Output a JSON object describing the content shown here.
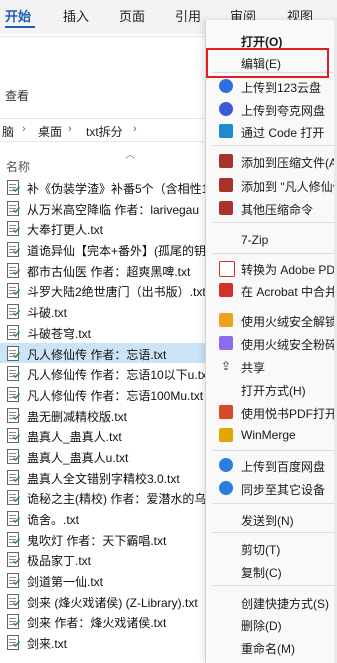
{
  "ribbon": {
    "tabs": [
      {
        "label": "开始",
        "active": true
      },
      {
        "label": "插入"
      },
      {
        "label": "页面"
      },
      {
        "label": "引用"
      },
      {
        "label": "审阅"
      },
      {
        "label": "视图"
      }
    ]
  },
  "toolbar": {
    "view_label": "查看"
  },
  "breadcrumb": [
    "脑",
    "桌面",
    "txt拆分"
  ],
  "columns": {
    "name": "名称"
  },
  "files": [
    {
      "name": "补《伪装学渣》补番5个（含相性1"
    },
    {
      "name": "从万米高空降临 作者：larivegau"
    },
    {
      "name": "大奉打更人.txt"
    },
    {
      "name": "道诡异仙【完本+番外】(孤尾的钥"
    },
    {
      "name": "都市古仙医 作者：超爽黑啤.txt"
    },
    {
      "name": "斗罗大陆2绝世唐门（出书版）.txt"
    },
    {
      "name": "斗破.txt"
    },
    {
      "name": "斗破苍穹.txt"
    },
    {
      "name": "凡人修仙传 作者：忘语.txt",
      "selected": true
    },
    {
      "name": "凡人修仙传 作者：忘语10以下u.tx"
    },
    {
      "name": "凡人修仙传 作者：忘语100Mu.txt"
    },
    {
      "name": "蛊无删减精校版.txt"
    },
    {
      "name": "蛊真人_蛊真人.txt"
    },
    {
      "name": "蛊真人_蛊真人u.txt"
    },
    {
      "name": "蛊真人全文错别字精校3.0.txt"
    },
    {
      "name": "诡秘之主(精校) 作者：爱潜水的乌"
    },
    {
      "name": "诡舍。.txt"
    },
    {
      "name": "鬼吹灯 作者：天下霸唱.txt"
    },
    {
      "name": "极品家丁.txt"
    },
    {
      "name": "剑道第一仙.txt"
    },
    {
      "name": "剑来 (烽火戏诸侯) (Z-Library).txt"
    },
    {
      "name": "剑来 作者：烽火戏诸侯.txt"
    },
    {
      "name": "剑来.txt"
    }
  ],
  "context_menu": {
    "items": [
      {
        "label": "打开(O)",
        "bold": true,
        "icon": "none"
      },
      {
        "label": "编辑(E)",
        "icon": "none",
        "highlighted": true
      },
      {
        "label": "上传到123云盘",
        "icon": "cloud-123-icon",
        "color": "#2f6fe0"
      },
      {
        "label": "上传到夸克网盘",
        "icon": "quark-icon",
        "color": "#3b5bdb"
      },
      {
        "label": "通过 Code 打开",
        "icon": "vscode-icon",
        "color": "#1f8ad2"
      },
      {
        "label": "添加到压缩文件(A)",
        "icon": "archive-icon",
        "color": "#a8332a"
      },
      {
        "label": "添加到 \"凡人修仙传",
        "icon": "archive-icon",
        "color": "#a8332a"
      },
      {
        "label": "其他压缩命令",
        "icon": "archive-icon",
        "color": "#a8332a"
      },
      {
        "label": "7-Zip",
        "icon": "none"
      },
      {
        "label": "转换为 Adobe PD",
        "icon": "pdf-icon",
        "color": "#d32f2f"
      },
      {
        "label": "在 Acrobat 中合并",
        "icon": "acrobat-icon",
        "color": "#d32f2f"
      },
      {
        "label": "使用火绒安全解锁",
        "icon": "huorong-folder-icon",
        "color": "#f0a020"
      },
      {
        "label": "使用火绒安全粉碎",
        "icon": "huorong-shred-icon",
        "color": "#8e6cf0"
      },
      {
        "label": "共享",
        "icon": "share-icon",
        "color": "#333333"
      },
      {
        "label": "打开方式(H)",
        "icon": "none"
      },
      {
        "label": "使用悦书PDF打开",
        "icon": "yueshu-pdf-icon",
        "color": "#d84a2a"
      },
      {
        "label": "WinMerge",
        "icon": "winmerge-icon",
        "color": "#e2a600"
      },
      {
        "label": "上传到百度网盘",
        "icon": "baidu-icon",
        "color": "#2a7de1"
      },
      {
        "label": "同步至其它设备",
        "icon": "baidu-sync-icon",
        "color": "#2a7de1"
      },
      {
        "label": "发送到(N)",
        "icon": "none"
      },
      {
        "label": "剪切(T)",
        "icon": "none"
      },
      {
        "label": "复制(C)",
        "icon": "none"
      },
      {
        "label": "创建快捷方式(S)",
        "icon": "none"
      },
      {
        "label": "删除(D)",
        "icon": "none"
      },
      {
        "label": "重命名(M)",
        "icon": "none"
      }
    ]
  }
}
